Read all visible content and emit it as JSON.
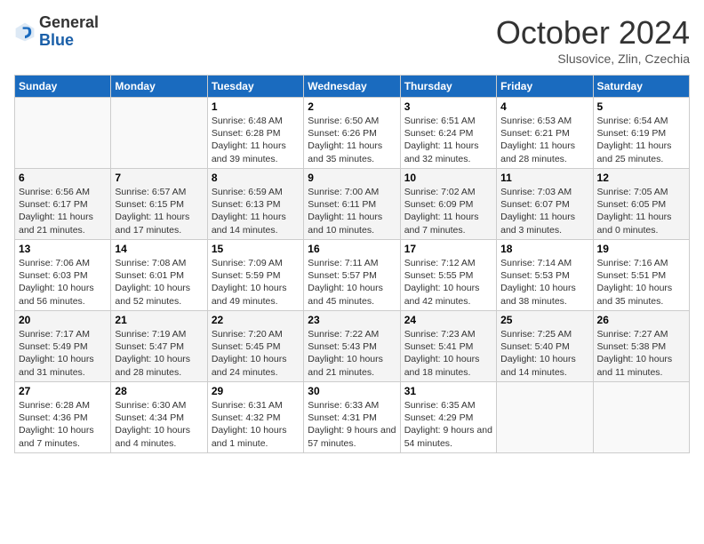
{
  "header": {
    "logo_line1": "General",
    "logo_line2": "Blue",
    "month": "October 2024",
    "location": "Slusovice, Zlin, Czechia"
  },
  "days_of_week": [
    "Sunday",
    "Monday",
    "Tuesday",
    "Wednesday",
    "Thursday",
    "Friday",
    "Saturday"
  ],
  "weeks": [
    [
      {
        "day": "",
        "info": ""
      },
      {
        "day": "",
        "info": ""
      },
      {
        "day": "1",
        "info": "Sunrise: 6:48 AM\nSunset: 6:28 PM\nDaylight: 11 hours and 39 minutes."
      },
      {
        "day": "2",
        "info": "Sunrise: 6:50 AM\nSunset: 6:26 PM\nDaylight: 11 hours and 35 minutes."
      },
      {
        "day": "3",
        "info": "Sunrise: 6:51 AM\nSunset: 6:24 PM\nDaylight: 11 hours and 32 minutes."
      },
      {
        "day": "4",
        "info": "Sunrise: 6:53 AM\nSunset: 6:21 PM\nDaylight: 11 hours and 28 minutes."
      },
      {
        "day": "5",
        "info": "Sunrise: 6:54 AM\nSunset: 6:19 PM\nDaylight: 11 hours and 25 minutes."
      }
    ],
    [
      {
        "day": "6",
        "info": "Sunrise: 6:56 AM\nSunset: 6:17 PM\nDaylight: 11 hours and 21 minutes."
      },
      {
        "day": "7",
        "info": "Sunrise: 6:57 AM\nSunset: 6:15 PM\nDaylight: 11 hours and 17 minutes."
      },
      {
        "day": "8",
        "info": "Sunrise: 6:59 AM\nSunset: 6:13 PM\nDaylight: 11 hours and 14 minutes."
      },
      {
        "day": "9",
        "info": "Sunrise: 7:00 AM\nSunset: 6:11 PM\nDaylight: 11 hours and 10 minutes."
      },
      {
        "day": "10",
        "info": "Sunrise: 7:02 AM\nSunset: 6:09 PM\nDaylight: 11 hours and 7 minutes."
      },
      {
        "day": "11",
        "info": "Sunrise: 7:03 AM\nSunset: 6:07 PM\nDaylight: 11 hours and 3 minutes."
      },
      {
        "day": "12",
        "info": "Sunrise: 7:05 AM\nSunset: 6:05 PM\nDaylight: 11 hours and 0 minutes."
      }
    ],
    [
      {
        "day": "13",
        "info": "Sunrise: 7:06 AM\nSunset: 6:03 PM\nDaylight: 10 hours and 56 minutes."
      },
      {
        "day": "14",
        "info": "Sunrise: 7:08 AM\nSunset: 6:01 PM\nDaylight: 10 hours and 52 minutes."
      },
      {
        "day": "15",
        "info": "Sunrise: 7:09 AM\nSunset: 5:59 PM\nDaylight: 10 hours and 49 minutes."
      },
      {
        "day": "16",
        "info": "Sunrise: 7:11 AM\nSunset: 5:57 PM\nDaylight: 10 hours and 45 minutes."
      },
      {
        "day": "17",
        "info": "Sunrise: 7:12 AM\nSunset: 5:55 PM\nDaylight: 10 hours and 42 minutes."
      },
      {
        "day": "18",
        "info": "Sunrise: 7:14 AM\nSunset: 5:53 PM\nDaylight: 10 hours and 38 minutes."
      },
      {
        "day": "19",
        "info": "Sunrise: 7:16 AM\nSunset: 5:51 PM\nDaylight: 10 hours and 35 minutes."
      }
    ],
    [
      {
        "day": "20",
        "info": "Sunrise: 7:17 AM\nSunset: 5:49 PM\nDaylight: 10 hours and 31 minutes."
      },
      {
        "day": "21",
        "info": "Sunrise: 7:19 AM\nSunset: 5:47 PM\nDaylight: 10 hours and 28 minutes."
      },
      {
        "day": "22",
        "info": "Sunrise: 7:20 AM\nSunset: 5:45 PM\nDaylight: 10 hours and 24 minutes."
      },
      {
        "day": "23",
        "info": "Sunrise: 7:22 AM\nSunset: 5:43 PM\nDaylight: 10 hours and 21 minutes."
      },
      {
        "day": "24",
        "info": "Sunrise: 7:23 AM\nSunset: 5:41 PM\nDaylight: 10 hours and 18 minutes."
      },
      {
        "day": "25",
        "info": "Sunrise: 7:25 AM\nSunset: 5:40 PM\nDaylight: 10 hours and 14 minutes."
      },
      {
        "day": "26",
        "info": "Sunrise: 7:27 AM\nSunset: 5:38 PM\nDaylight: 10 hours and 11 minutes."
      }
    ],
    [
      {
        "day": "27",
        "info": "Sunrise: 6:28 AM\nSunset: 4:36 PM\nDaylight: 10 hours and 7 minutes."
      },
      {
        "day": "28",
        "info": "Sunrise: 6:30 AM\nSunset: 4:34 PM\nDaylight: 10 hours and 4 minutes."
      },
      {
        "day": "29",
        "info": "Sunrise: 6:31 AM\nSunset: 4:32 PM\nDaylight: 10 hours and 1 minute."
      },
      {
        "day": "30",
        "info": "Sunrise: 6:33 AM\nSunset: 4:31 PM\nDaylight: 9 hours and 57 minutes."
      },
      {
        "day": "31",
        "info": "Sunrise: 6:35 AM\nSunset: 4:29 PM\nDaylight: 9 hours and 54 minutes."
      },
      {
        "day": "",
        "info": ""
      },
      {
        "day": "",
        "info": ""
      }
    ]
  ]
}
